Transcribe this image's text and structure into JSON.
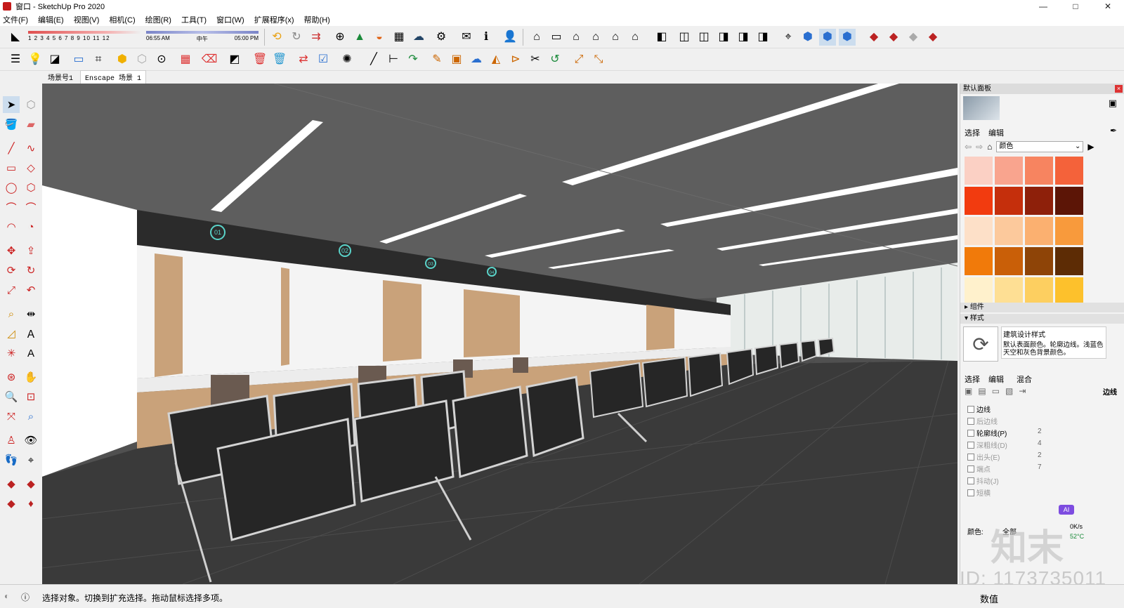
{
  "window": {
    "title": "窗口 - SketchUp Pro 2020",
    "min": "—",
    "max": "□",
    "close": "✕"
  },
  "menu": [
    "文件(F)",
    "编辑(E)",
    "视图(V)",
    "相机(C)",
    "绘图(R)",
    "工具(T)",
    "窗口(W)",
    "扩展程序(x)",
    "帮助(H)"
  ],
  "shadow": {
    "months": "1 2 3 4 5 6 7 8 9 10 11 12",
    "time_start": "06:55 AM",
    "time_mid": "中午",
    "time_end": "05:00 PM"
  },
  "scenes": [
    "场景号1",
    "Enscape 场景 1"
  ],
  "panel": {
    "title": "默认面板",
    "tab_select": "选择",
    "tab_edit": "编辑",
    "color_dropdown": "颜色",
    "swatches": [
      "#fbd0c4",
      "#f9a48e",
      "#f78460",
      "#f4623a",
      "#f23b0f",
      "#c52f0c",
      "#8e200a",
      "#5c1506",
      "#fde0c8",
      "#fcc99c",
      "#fbb070",
      "#f89a3c",
      "#f17a0a",
      "#c95f08",
      "#8e4407",
      "#5d2c05",
      "#fff1cc",
      "#fedf94",
      "#fdcf60",
      "#fdc12c"
    ],
    "colors_label": "颜色",
    "components": "组件",
    "styles": "样式",
    "style_name": "建筑设计样式",
    "style_desc": "默认表面颜色。轮廓边线。浅蓝色天空和灰色背景颜色。",
    "style_tabs": [
      "选择",
      "编辑",
      "混合"
    ],
    "edge_label": "边线",
    "edge_settings": [
      {
        "label": "边线",
        "value": "",
        "dim": false
      },
      {
        "label": "后边线",
        "value": "",
        "dim": true
      },
      {
        "label": "轮廓线(P)",
        "value": "2",
        "dim": false
      },
      {
        "label": "深粗线(D)",
        "value": "4",
        "dim": true
      },
      {
        "label": "出头(E)",
        "value": "2",
        "dim": true
      },
      {
        "label": "端点",
        "value": "7",
        "dim": true
      },
      {
        "label": "抖动(J)",
        "value": "",
        "dim": true
      },
      {
        "label": "短横",
        "value": "",
        "dim": true
      }
    ],
    "color_field": "颜色:",
    "color_value": "全部",
    "speed": "0K/s",
    "temp": "52°C",
    "ai_badge": "AI"
  },
  "status": {
    "message": "选择对象。切换到扩充选择。拖动鼠标选择多项。",
    "measurements": "数值"
  },
  "watermark": {
    "id": "ID: 1173735011",
    "brand": "知末"
  },
  "viewport": {
    "counter_labels": [
      "01",
      "02",
      "03",
      "04"
    ],
    "colors": {
      "ceiling": "#5e5e5e",
      "floor": "#3a3a3a",
      "wall": "#ffffff",
      "wood": "#c9a27a",
      "chair": "#2a2a2a",
      "frame": "#d4d4d4"
    }
  }
}
